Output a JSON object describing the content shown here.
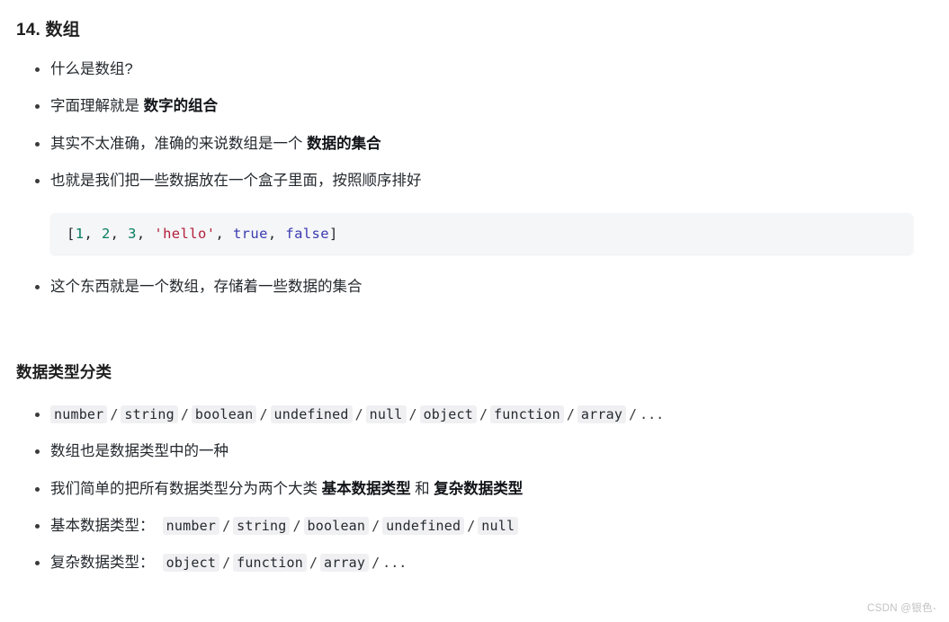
{
  "document": {
    "heading": "14. 数组",
    "subheading": "数据类型分类",
    "background_color": "#ffffff",
    "text_color": "#24292e"
  },
  "intro_list": [
    {
      "parts": [
        {
          "text": "什么是数组?",
          "bold": false
        }
      ]
    },
    {
      "parts": [
        {
          "text": "字面理解就是 ",
          "bold": false
        },
        {
          "text": "数字的组合",
          "bold": true
        }
      ]
    },
    {
      "parts": [
        {
          "text": "其实不太准确，准确的来说数组是一个 ",
          "bold": false
        },
        {
          "text": "数据的集合",
          "bold": true
        }
      ]
    },
    {
      "parts": [
        {
          "text": "也就是我们把一些数据放在一个盒子里面，按照顺序排好",
          "bold": false
        }
      ]
    }
  ],
  "code_block": {
    "language": "javascript",
    "background_color": "#f5f6f8",
    "tokens": [
      {
        "text": "[",
        "type": "punct"
      },
      {
        "text": "1",
        "type": "number"
      },
      {
        "text": ", ",
        "type": "punct"
      },
      {
        "text": "2",
        "type": "number"
      },
      {
        "text": ", ",
        "type": "punct"
      },
      {
        "text": "3",
        "type": "number"
      },
      {
        "text": ", ",
        "type": "punct"
      },
      {
        "text": "'hello'",
        "type": "string"
      },
      {
        "text": ", ",
        "type": "punct"
      },
      {
        "text": "true",
        "type": "bool"
      },
      {
        "text": ", ",
        "type": "punct"
      },
      {
        "text": "false",
        "type": "bool"
      },
      {
        "text": "]",
        "type": "punct"
      }
    ],
    "plain_text": "[1, 2, 3, 'hello', true, false]"
  },
  "after_code_list": [
    {
      "parts": [
        {
          "text": "这个东西就是一个数组，存储着一些数据的集合",
          "bold": false
        }
      ]
    }
  ],
  "types_list": {
    "all_types_label": "",
    "all_types": [
      "number",
      "string",
      "boolean",
      "undefined",
      "null",
      "object",
      "function",
      "array"
    ],
    "all_types_trailing": "...",
    "note": "数组也是数据类型中的一种",
    "split_sentence": {
      "prefix": "我们简单的把所有数据类型分为两个大类 ",
      "bold_1": "基本数据类型",
      "middle": " 和 ",
      "bold_2": "复杂数据类型"
    },
    "primitive_label": "基本数据类型：",
    "primitive_types": [
      "number",
      "string",
      "boolean",
      "undefined",
      "null"
    ],
    "complex_label": "复杂数据类型：",
    "complex_types": [
      "object",
      "function",
      "array"
    ],
    "complex_trailing": "...",
    "separator": "/"
  },
  "watermark": {
    "text": "CSDN @银色-",
    "color": "#c2c2c4"
  }
}
